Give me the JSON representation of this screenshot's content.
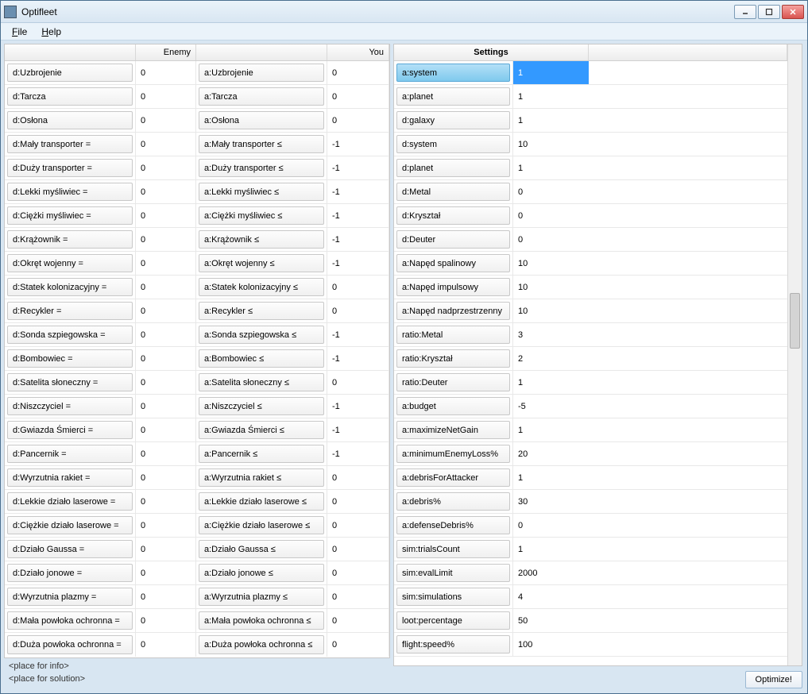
{
  "window": {
    "title": "Optifleet"
  },
  "menu": {
    "file": "File",
    "file_u": "F",
    "help": "Help",
    "help_u": "H"
  },
  "headers": {
    "enemy": "Enemy",
    "you": "You",
    "settings": "Settings"
  },
  "winbuttons": {
    "min": "minimize",
    "max": "maximize",
    "close": "close"
  },
  "rows": [
    {
      "el": "d:Uzbrojenie",
      "ev": "0",
      "yl": "a:Uzbrojenie",
      "yv": "0"
    },
    {
      "el": "d:Tarcza",
      "ev": "0",
      "yl": "a:Tarcza",
      "yv": "0"
    },
    {
      "el": "d:Osłona",
      "ev": "0",
      "yl": "a:Osłona",
      "yv": "0"
    },
    {
      "el": "d:Mały transporter =",
      "ev": "0",
      "yl": "a:Mały transporter ≤",
      "yv": "-1"
    },
    {
      "el": "d:Duży transporter =",
      "ev": "0",
      "yl": "a:Duży transporter ≤",
      "yv": "-1"
    },
    {
      "el": "d:Lekki myśliwiec =",
      "ev": "0",
      "yl": "a:Lekki myśliwiec ≤",
      "yv": "-1"
    },
    {
      "el": "d:Ciężki myśliwiec =",
      "ev": "0",
      "yl": "a:Ciężki myśliwiec ≤",
      "yv": "-1"
    },
    {
      "el": "d:Krążownik =",
      "ev": "0",
      "yl": "a:Krążownik ≤",
      "yv": "-1"
    },
    {
      "el": "d:Okręt wojenny =",
      "ev": "0",
      "yl": "a:Okręt wojenny ≤",
      "yv": "-1"
    },
    {
      "el": "d:Statek kolonizacyjny =",
      "ev": "0",
      "yl": "a:Statek kolonizacyjny ≤",
      "yv": "0"
    },
    {
      "el": "d:Recykler =",
      "ev": "0",
      "yl": "a:Recykler ≤",
      "yv": "0"
    },
    {
      "el": "d:Sonda szpiegowska =",
      "ev": "0",
      "yl": "a:Sonda szpiegowska ≤",
      "yv": "-1"
    },
    {
      "el": "d:Bombowiec =",
      "ev": "0",
      "yl": "a:Bombowiec ≤",
      "yv": "-1"
    },
    {
      "el": "d:Satelita słoneczny =",
      "ev": "0",
      "yl": "a:Satelita słoneczny ≤",
      "yv": "0"
    },
    {
      "el": "d:Niszczyciel =",
      "ev": "0",
      "yl": "a:Niszczyciel ≤",
      "yv": "-1"
    },
    {
      "el": "d:Gwiazda Śmierci =",
      "ev": "0",
      "yl": "a:Gwiazda Śmierci ≤",
      "yv": "-1"
    },
    {
      "el": "d:Pancernik =",
      "ev": "0",
      "yl": "a:Pancernik ≤",
      "yv": "-1"
    },
    {
      "el": "d:Wyrzutnia rakiet =",
      "ev": "0",
      "yl": "a:Wyrzutnia rakiet ≤",
      "yv": "0"
    },
    {
      "el": "d:Lekkie działo laserowe =",
      "ev": "0",
      "yl": "a:Lekkie działo laserowe ≤",
      "yv": "0"
    },
    {
      "el": "d:Ciężkie działo laserowe =",
      "ev": "0",
      "yl": "a:Ciężkie działo laserowe ≤",
      "yv": "0"
    },
    {
      "el": "d:Działo Gaussa =",
      "ev": "0",
      "yl": "a:Działo Gaussa ≤",
      "yv": "0"
    },
    {
      "el": "d:Działo jonowe =",
      "ev": "0",
      "yl": "a:Działo jonowe ≤",
      "yv": "0"
    },
    {
      "el": "d:Wyrzutnia plazmy =",
      "ev": "0",
      "yl": "a:Wyrzutnia plazmy ≤",
      "yv": "0"
    },
    {
      "el": "d:Mała powłoka ochronna =",
      "ev": "0",
      "yl": "a:Mała powłoka ochronna ≤",
      "yv": "0"
    },
    {
      "el": "d:Duża powłoka ochronna =",
      "ev": "0",
      "yl": "a:Duża powłoka ochronna ≤",
      "yv": "0"
    }
  ],
  "settings": [
    {
      "k": "a:system",
      "v": "1",
      "sel": true
    },
    {
      "k": "a:planet",
      "v": "1"
    },
    {
      "k": "d:galaxy",
      "v": "1"
    },
    {
      "k": "d:system",
      "v": "10"
    },
    {
      "k": "d:planet",
      "v": "1"
    },
    {
      "k": "d:Metal",
      "v": "0"
    },
    {
      "k": "d:Kryształ",
      "v": "0"
    },
    {
      "k": "d:Deuter",
      "v": "0"
    },
    {
      "k": "a:Napęd spalinowy",
      "v": "10"
    },
    {
      "k": "a:Napęd impulsowy",
      "v": "10"
    },
    {
      "k": "a:Napęd nadprzestrzenny",
      "v": "10"
    },
    {
      "k": "ratio:Metal",
      "v": "3"
    },
    {
      "k": "ratio:Kryształ",
      "v": "2"
    },
    {
      "k": "ratio:Deuter",
      "v": "1"
    },
    {
      "k": "a:budget",
      "v": "-5"
    },
    {
      "k": "a:maximizeNetGain",
      "v": "1"
    },
    {
      "k": "a:minimumEnemyLoss%",
      "v": "20"
    },
    {
      "k": "a:debrisForAttacker",
      "v": "1"
    },
    {
      "k": "a:debris%",
      "v": "30"
    },
    {
      "k": "a:defenseDebris%",
      "v": "0"
    },
    {
      "k": "sim:trialsCount",
      "v": "1"
    },
    {
      "k": "sim:evalLimit",
      "v": "2000"
    },
    {
      "k": "sim:simulations",
      "v": "4"
    },
    {
      "k": "loot:percentage",
      "v": "50"
    },
    {
      "k": "flight:speed%",
      "v": "100"
    }
  ],
  "buttons": {
    "optimize": "Optimize!"
  },
  "footer": {
    "info": "<place for info>",
    "solution": "<place for solution>"
  }
}
